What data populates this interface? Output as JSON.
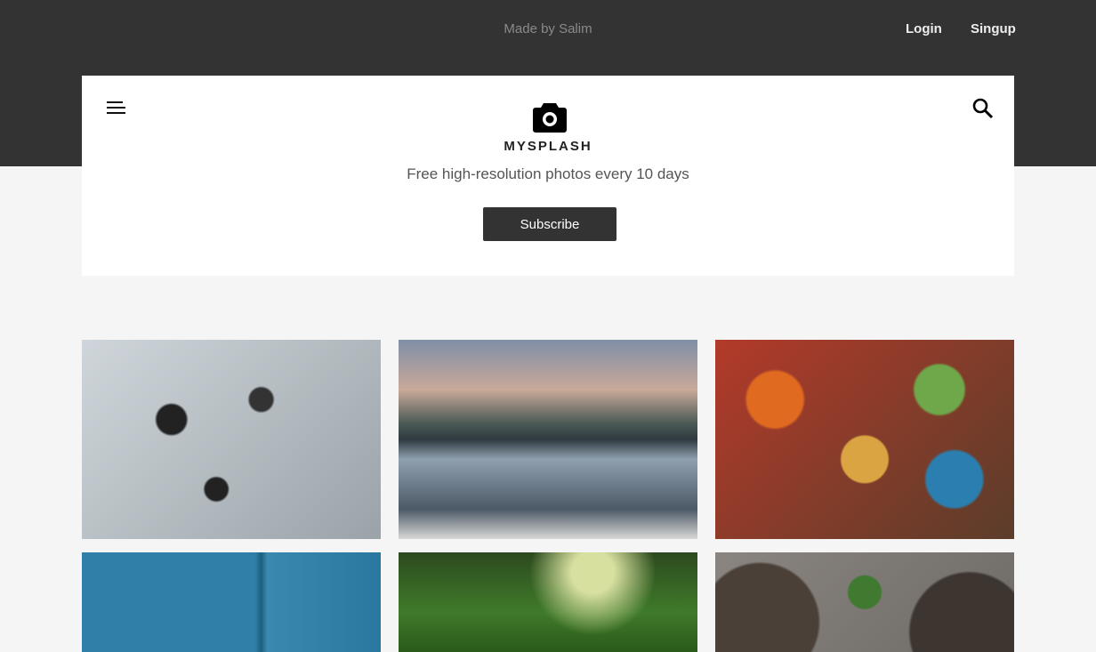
{
  "topbar": {
    "credit": "Made by Salim",
    "login": "Login",
    "signup": "Singup"
  },
  "header": {
    "brand": "MYSPLASH",
    "tagline": "Free high-resolution photos every 10 days",
    "subscribe": "Subscribe"
  },
  "photos": [
    {
      "name": "people-walking-photo"
    },
    {
      "name": "woman-lake-mountain-photo"
    },
    {
      "name": "food-flatlay-photo"
    },
    {
      "name": "blue-wall-photo"
    },
    {
      "name": "forest-photo"
    },
    {
      "name": "salad-plates-photo"
    }
  ]
}
